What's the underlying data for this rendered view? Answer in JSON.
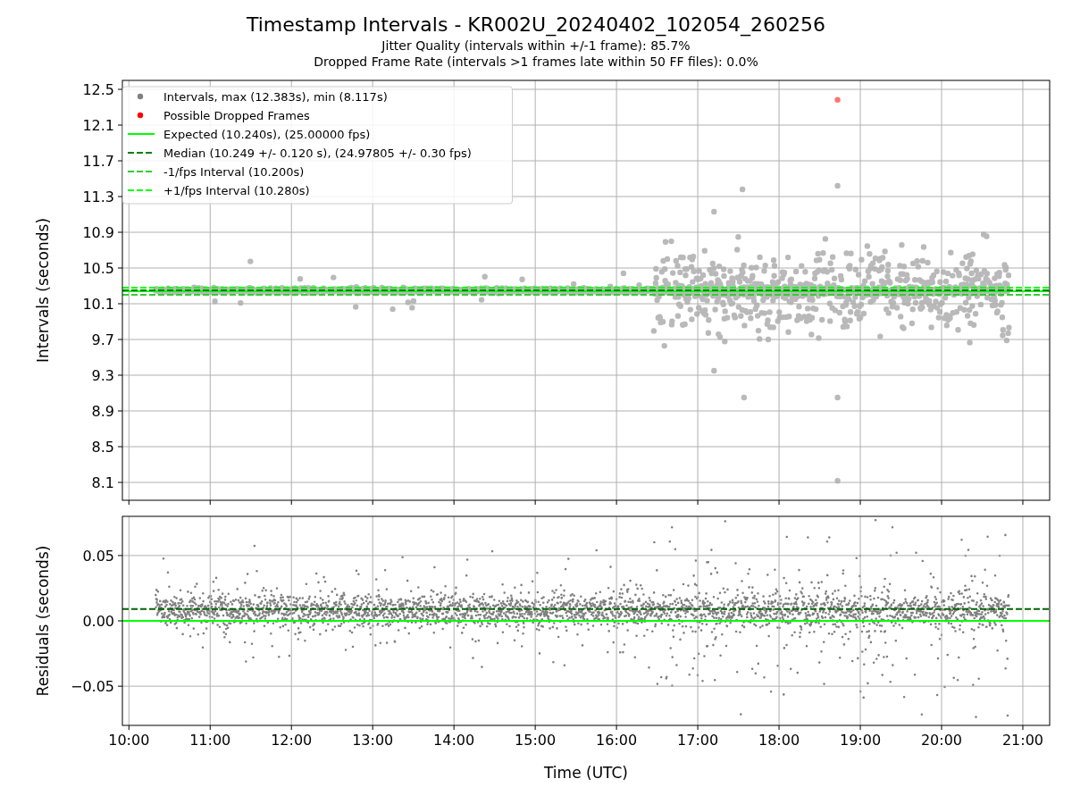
{
  "title": "Timestamp Intervals - KR002U_20240402_102054_260256",
  "subtitles": [
    "Jitter Quality (intervals within +/-1 frame): 85.7%",
    "Dropped Frame Rate (intervals >1 frames late within 50 FF files): 0.0%"
  ],
  "intervals_plot": {
    "point_legend": [
      {
        "label": "Intervals, max (12.383s), min (8.117s)",
        "color": "#808080"
      },
      {
        "label": "Possible Dropped Frames",
        "color": "#ff0000"
      }
    ],
    "chart_data": {
      "type": "line",
      "ylabel": "Intervals (seconds)",
      "x": [
        9.92,
        21.33
      ],
      "xlim": [
        9.92,
        21.33
      ],
      "ylim": [
        7.9,
        12.6
      ],
      "grid": true,
      "legend": true,
      "yticks": [
        {
          "value": 8.1,
          "label": "8.1"
        },
        {
          "value": 8.5,
          "label": "8.5"
        },
        {
          "value": 8.9,
          "label": "8.9"
        },
        {
          "value": 9.3,
          "label": "9.3"
        },
        {
          "value": 9.7,
          "label": "9.7"
        },
        {
          "value": 10.1,
          "label": "10.1"
        },
        {
          "value": 10.5,
          "label": "10.5"
        },
        {
          "value": 10.9,
          "label": "10.9"
        },
        {
          "value": 11.3,
          "label": "11.3"
        },
        {
          "value": 11.7,
          "label": "11.7"
        },
        {
          "value": 12.1,
          "label": "12.1"
        },
        {
          "value": 12.5,
          "label": "12.5"
        }
      ],
      "series": [
        {
          "name": "Expected (10.240s), (25.00000 fps)",
          "color": "#00ff00",
          "line_style": "solid",
          "values": [
            10.24,
            10.24
          ]
        },
        {
          "name": "Median (10.249 +/- 0.120 s), (24.97805 +/- 0.30 fps)",
          "color": "#008000",
          "line_style": "dashed",
          "values": [
            10.25,
            10.25
          ]
        },
        {
          "name": "-1/fps Interval (10.200s)",
          "color": "#32cd32",
          "line_style": "dashed",
          "values": [
            10.2,
            10.2
          ]
        },
        {
          "name": "+1/fps Interval (10.280s)",
          "color": "#00ff00",
          "line_style": "dashed",
          "values": [
            10.28,
            10.28
          ]
        }
      ]
    }
  },
  "residuals_plot": {
    "chart_data": {
      "type": "line",
      "ylabel": "Residuals (seconds)",
      "xlabel": "Time (UTC)",
      "x": [
        9.92,
        21.33
      ],
      "xlim": [
        9.92,
        21.33
      ],
      "ylim": [
        -0.08,
        0.08
      ],
      "xticks": [
        {
          "value": 10,
          "label": "10:00"
        },
        {
          "value": 11,
          "label": "11:00"
        },
        {
          "value": 12,
          "label": "12:00"
        },
        {
          "value": 13,
          "label": "13:00"
        },
        {
          "value": 14,
          "label": "14:00"
        },
        {
          "value": 15,
          "label": "15:00"
        },
        {
          "value": 16,
          "label": "16:00"
        },
        {
          "value": 17,
          "label": "17:00"
        },
        {
          "value": 18,
          "label": "18:00"
        },
        {
          "value": 19,
          "label": "19:00"
        },
        {
          "value": 20,
          "label": "20:00"
        },
        {
          "value": 21,
          "label": "21:00"
        }
      ],
      "yticks": [
        {
          "value": -0.05,
          "label": "−0.05"
        },
        {
          "value": 0,
          "label": "0.00"
        },
        {
          "value": 0.05,
          "label": "0.05"
        }
      ],
      "series": [
        {
          "color": "#00ff00",
          "line_style": "solid",
          "values": [
            0,
            0
          ]
        },
        {
          "color": "#006400",
          "line_style": "dashed",
          "values": [
            0.009,
            0.009
          ]
        }
      ],
      "grid": true
    }
  }
}
